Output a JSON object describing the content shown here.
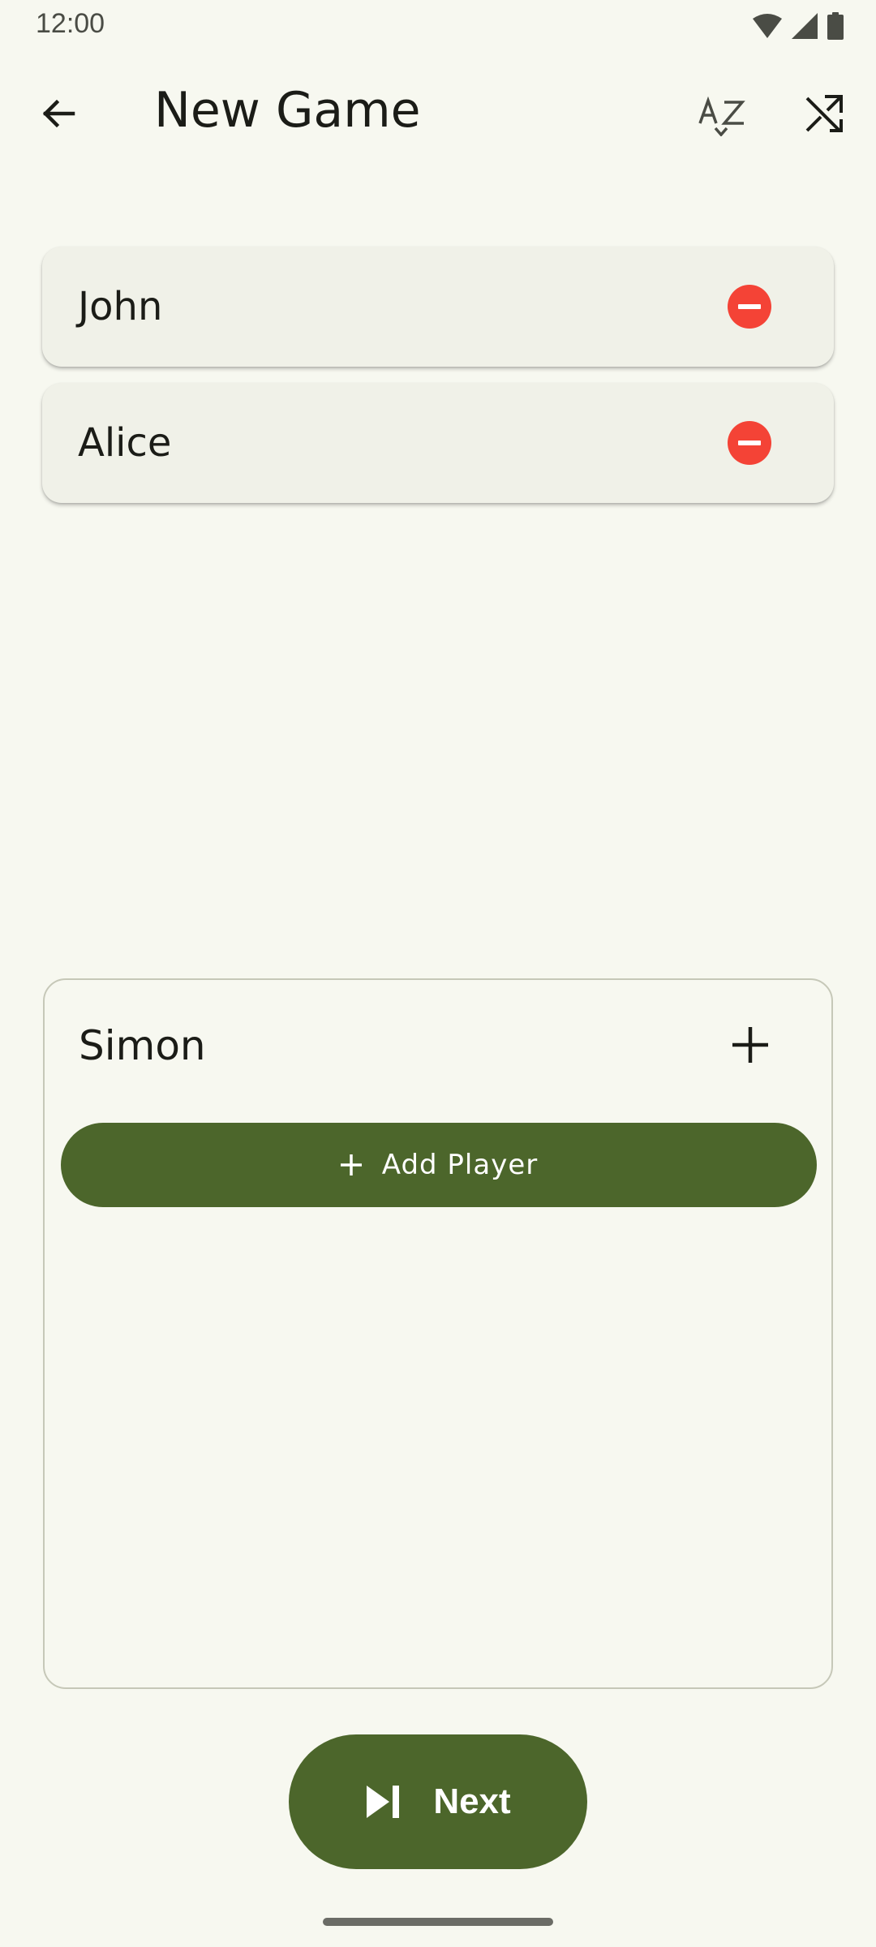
{
  "status_bar": {
    "time": "12:00",
    "icons": [
      "wifi-icon",
      "cell-signal-icon",
      "battery-icon"
    ]
  },
  "app_bar": {
    "title": "New Game",
    "actions": [
      "sort-alpha-icon",
      "shuffle-icon"
    ]
  },
  "players": [
    {
      "name": "John"
    },
    {
      "name": "Alice"
    }
  ],
  "input_panel": {
    "name_value": "Simon",
    "add_button_label": "Add Player"
  },
  "next_button": {
    "label": "Next"
  },
  "colors": {
    "background": "#f7f8f0",
    "primary": "#4c662b",
    "remove": "#f44336",
    "card": "#f0f1e8"
  }
}
